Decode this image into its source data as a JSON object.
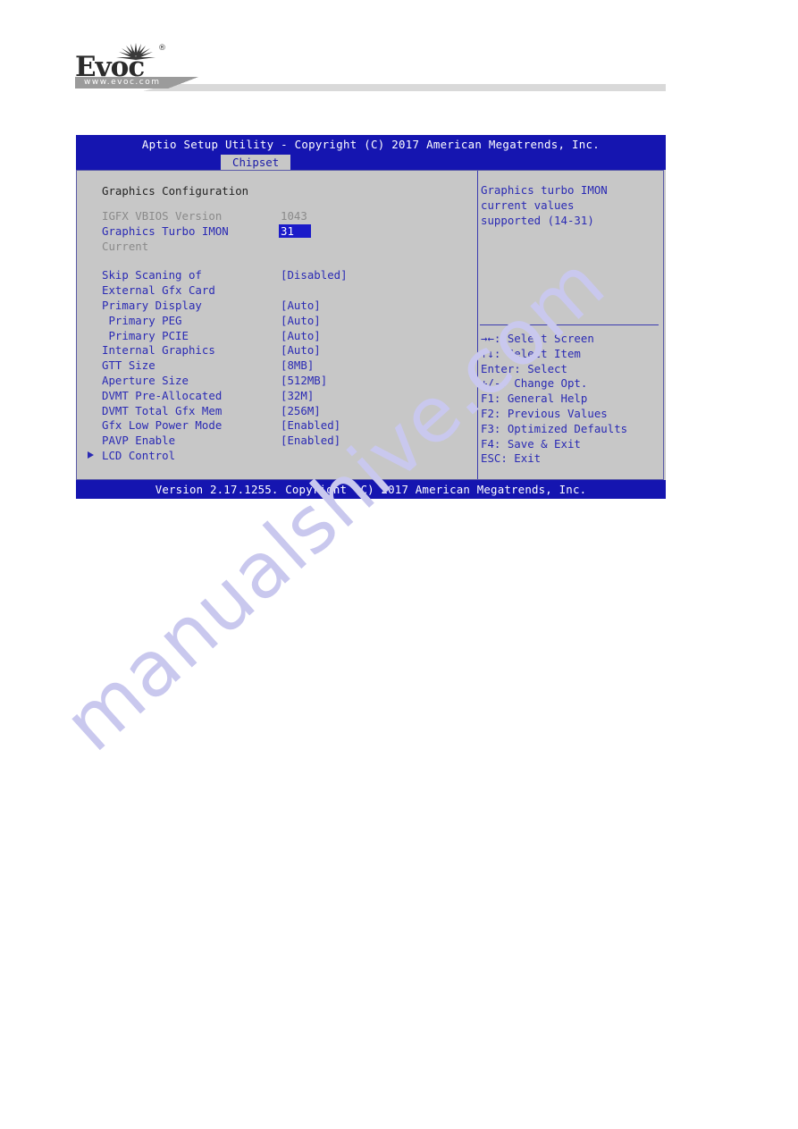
{
  "letterhead": {
    "brand": "Evoc",
    "registered_mark": "®",
    "url": "www.evoc.com"
  },
  "bios": {
    "title": "Aptio Setup Utility - Copyright (C) 2017 American Megatrends, Inc.",
    "active_tab": "Chipset",
    "footer": "Version 2.17.1255. Copyright (C) 2017 American Megatrends, Inc.",
    "section_title": "Graphics Configuration",
    "rows": [
      {
        "label": "IGFX VBIOS Version",
        "value": "1043",
        "state": "dim"
      },
      {
        "label": "Graphics Turbo IMON",
        "value": "31",
        "state": "selected"
      },
      {
        "label": "Current",
        "value": "",
        "state": "dim"
      },
      {
        "label": "Skip Scaning of",
        "value": "[Disabled]",
        "state": "normal"
      },
      {
        "label": "External Gfx Card",
        "value": "",
        "state": "normal"
      },
      {
        "label": "Primary Display",
        "value": "[Auto]",
        "state": "normal"
      },
      {
        "label": " Primary PEG",
        "value": "[Auto]",
        "state": "normal"
      },
      {
        "label": " Primary PCIE",
        "value": "[Auto]",
        "state": "normal"
      },
      {
        "label": "Internal Graphics",
        "value": "[Auto]",
        "state": "normal"
      },
      {
        "label": "GTT Size",
        "value": "[8MB]",
        "state": "normal"
      },
      {
        "label": "Aperture Size",
        "value": "[512MB]",
        "state": "normal"
      },
      {
        "label": "DVMT Pre-Allocated",
        "value": "[32M]",
        "state": "normal"
      },
      {
        "label": "DVMT Total Gfx Mem",
        "value": "[256M]",
        "state": "normal"
      },
      {
        "label": "Gfx Low Power Mode",
        "value": "[Enabled]",
        "state": "normal"
      },
      {
        "label": "PAVP Enable",
        "value": "[Enabled]",
        "state": "normal"
      },
      {
        "label": "LCD Control",
        "value": "",
        "state": "submenu"
      }
    ],
    "help": {
      "line1": "Graphics turbo IMON",
      "line2": "current values",
      "line3": "supported (14-31)"
    },
    "keys": [
      "→←: Select Screen",
      "↑↓: Select Item",
      "Enter: Select",
      "+/-: Change Opt.",
      "F1: General Help",
      "F2: Previous Values",
      "F3: Optimized Defaults",
      "F4: Save & Exit",
      "ESC: Exit"
    ]
  },
  "watermark": {
    "text": "manualshive.com"
  },
  "colors": {
    "bios_blue": "#1515b0",
    "bios_gray": "#c7c7c7",
    "text_blue": "#2a2ab4",
    "text_dim": "#8a8a8a",
    "highlight": "#1b1bc9"
  }
}
